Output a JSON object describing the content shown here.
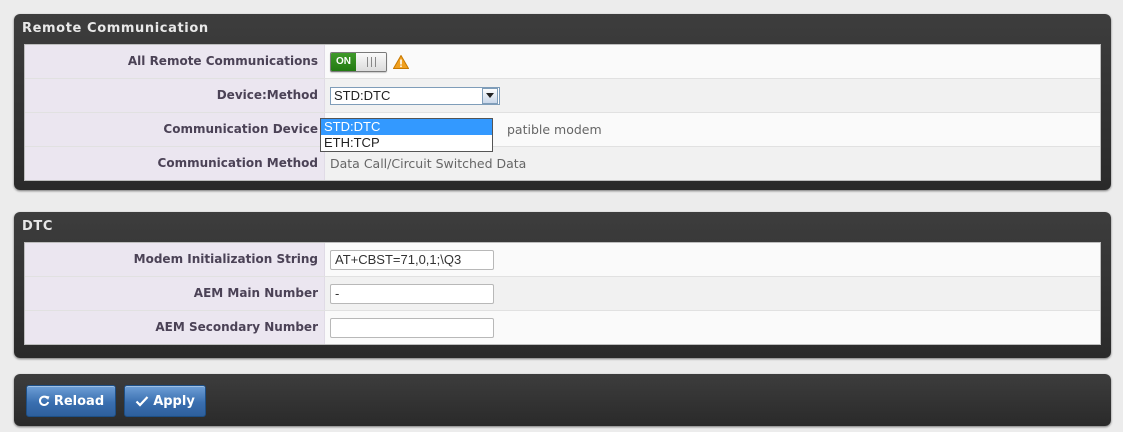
{
  "remote": {
    "title": "Remote Communication",
    "rows": [
      {
        "label": "All Remote Communications",
        "toggle": "ON"
      },
      {
        "label": "Device:Method",
        "select_value": "STD:DTC"
      },
      {
        "label": "Communication Device",
        "value": "...patible modem",
        "value_visible": "patible modem"
      },
      {
        "label": "Communication Method",
        "value": "Data Call/Circuit Switched Data"
      }
    ],
    "dropdown_options": [
      "STD:DTC",
      "ETH:TCP"
    ],
    "selected_option": "STD:DTC"
  },
  "dtc": {
    "title": "DTC",
    "rows": [
      {
        "label": "Modem Initialization String",
        "value": "AT+CBST=71,0,1;\\Q3"
      },
      {
        "label": "AEM Main Number",
        "value": "-"
      },
      {
        "label": "AEM Secondary Number",
        "value": ""
      }
    ]
  },
  "actions": {
    "reload_label": "Reload",
    "apply_label": "Apply"
  },
  "colors": {
    "panel": "#333333",
    "label_bg": "#ebe6f0",
    "toggle_on": "#2e8b1f",
    "warning": "#f0a020",
    "button": "#3a6fb0",
    "dropdown_highlight": "#3399ff"
  }
}
